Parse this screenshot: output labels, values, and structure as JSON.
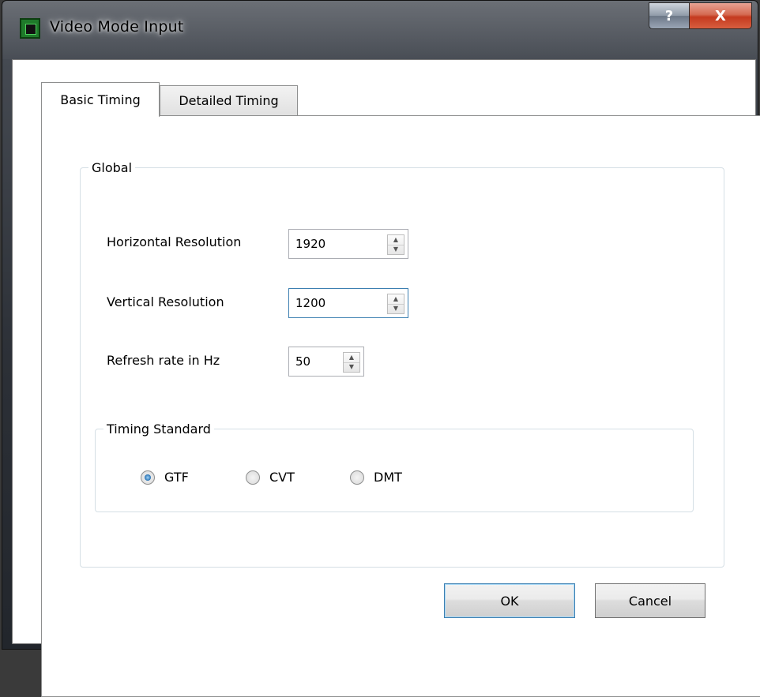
{
  "window": {
    "title": "Video Mode Input",
    "help_label": "?",
    "close_label": "X"
  },
  "tabs": [
    {
      "label": "Basic Timing",
      "selected": true
    },
    {
      "label": "Detailed Timing",
      "selected": false
    }
  ],
  "global": {
    "legend": "Global",
    "fields": {
      "horizontal": {
        "label": "Horizontal Resolution",
        "value": "1920"
      },
      "vertical": {
        "label": "Vertical Resolution",
        "value": "1200"
      },
      "refresh": {
        "label": "Refresh rate in Hz",
        "value": "50"
      }
    }
  },
  "timing_standard": {
    "legend": "Timing Standard",
    "options": [
      {
        "label": "GTF",
        "checked": true
      },
      {
        "label": "CVT",
        "checked": false
      },
      {
        "label": "DMT",
        "checked": false
      }
    ]
  },
  "buttons": {
    "ok": "OK",
    "cancel": "Cancel"
  }
}
